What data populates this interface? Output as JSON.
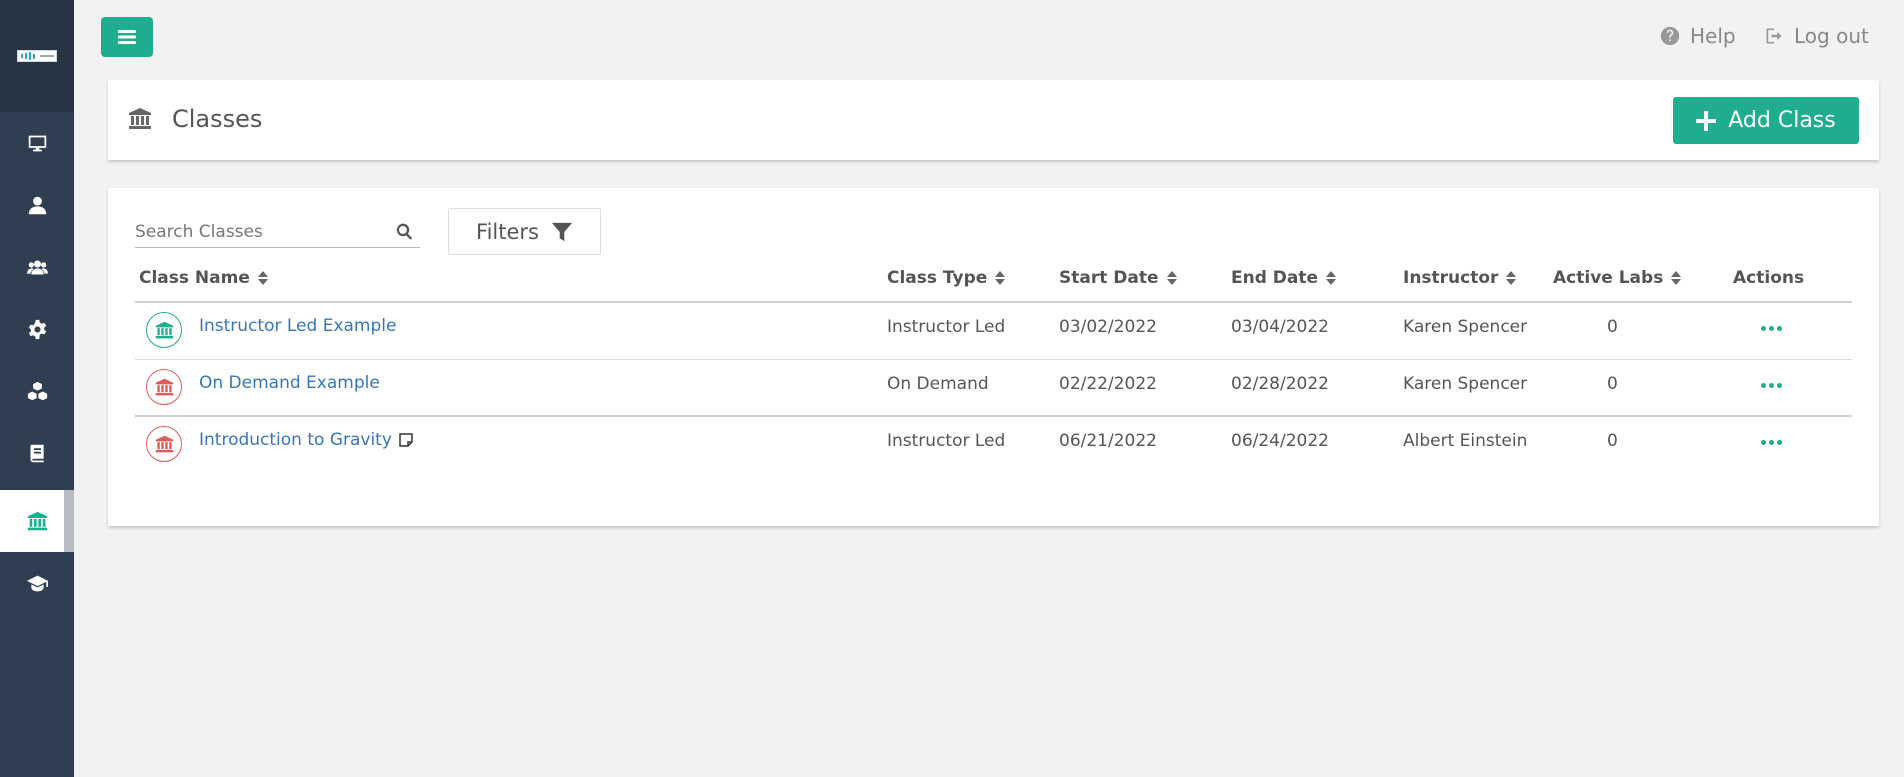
{
  "topbar": {
    "help_label": "Help",
    "logout_label": "Log out"
  },
  "sidebar": {
    "items": [
      {
        "name": "monitor-icon"
      },
      {
        "name": "user-icon"
      },
      {
        "name": "users-icon"
      },
      {
        "name": "gear-icon"
      },
      {
        "name": "cubes-icon"
      },
      {
        "name": "book-icon"
      },
      {
        "name": "institution-icon",
        "active": true
      },
      {
        "name": "graduation-cap-icon"
      }
    ]
  },
  "page": {
    "title": "Classes",
    "add_button_label": "Add Class"
  },
  "search": {
    "placeholder": "Search Classes"
  },
  "filters": {
    "label": "Filters"
  },
  "table": {
    "columns": [
      "Class Name",
      "Class Type",
      "Start Date",
      "End Date",
      "Instructor",
      "Active Labs",
      "Actions"
    ],
    "rows": [
      {
        "name": "Instructor Led Example",
        "type": "Instructor Led",
        "start": "03/02/2022",
        "end": "03/04/2022",
        "instructor": "Karen Spencer",
        "active_labs": "0",
        "status_color": "green",
        "has_note": false
      },
      {
        "name": "On Demand Example",
        "type": "On Demand",
        "start": "02/22/2022",
        "end": "02/28/2022",
        "instructor": "Karen Spencer",
        "active_labs": "0",
        "status_color": "red",
        "has_note": false
      },
      {
        "name": "Introduction to Gravity",
        "type": "Instructor Led",
        "start": "06/21/2022",
        "end": "06/24/2022",
        "instructor": "Albert Einstein",
        "active_labs": "0",
        "status_color": "red",
        "has_note": true
      }
    ]
  },
  "colors": {
    "accent": "#1fad8f",
    "sidebar": "#2f3e51",
    "link": "#3777b8",
    "inactive": "#e05a5a"
  }
}
